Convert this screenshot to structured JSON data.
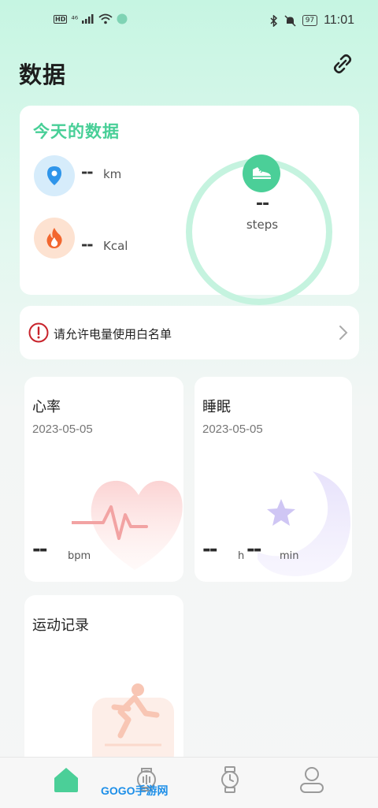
{
  "status_bar": {
    "hd": "HD",
    "signal": "⁴⁶",
    "battery": "97",
    "time": "11:01"
  },
  "header": {
    "title": "数据"
  },
  "today": {
    "title": "今天的数据",
    "distance_value": "--",
    "distance_unit": "km",
    "calories_value": "--",
    "calories_unit": "Kcal",
    "steps_value": "--",
    "steps_unit": "steps"
  },
  "whitelist": {
    "text": "请允许电量使用白名单"
  },
  "heart": {
    "title": "心率",
    "date": "2023-05-05",
    "value": "--",
    "unit": "bpm"
  },
  "sleep": {
    "title": "睡眠",
    "date": "2023-05-05",
    "hours_value": "--",
    "hours_unit": "h",
    "minutes_value": "--",
    "minutes_unit": "min"
  },
  "sport": {
    "title": "运动记录"
  },
  "nav": {
    "items": [
      "home-icon",
      "device-icon",
      "watch-icon",
      "profile-icon"
    ],
    "active_color": "#4bcf98"
  },
  "watermark": "GOGO手游网",
  "colors": {
    "accent": "#48cf97",
    "ring": "#c5f3df",
    "heart": "#f8c6c6",
    "sleep": "#e2ddfa"
  }
}
